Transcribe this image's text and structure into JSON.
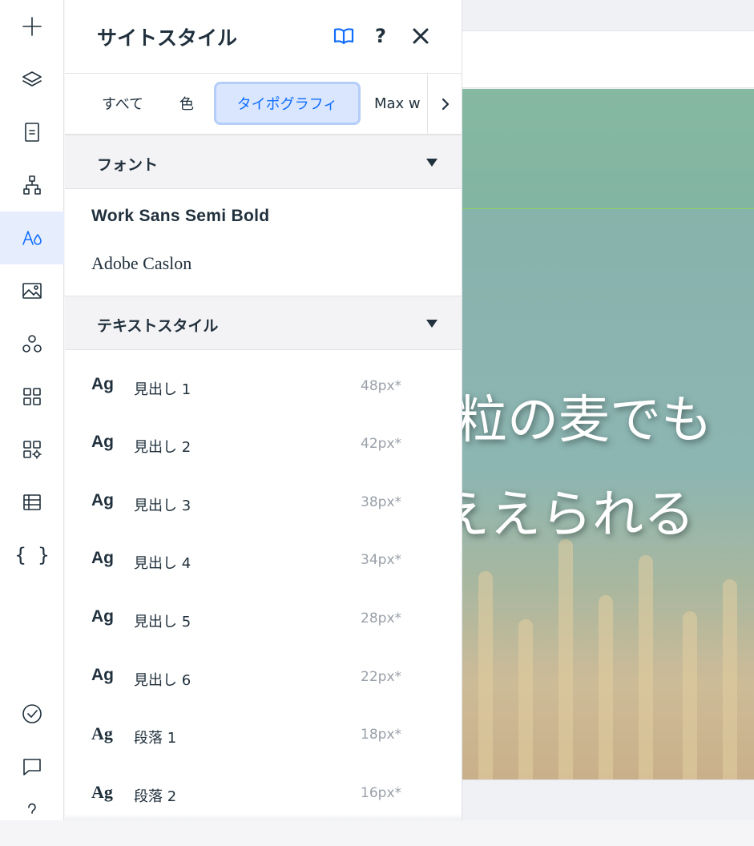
{
  "rail": {
    "items": [
      {
        "name": "add-icon",
        "active": false
      },
      {
        "name": "layers-icon",
        "active": false
      },
      {
        "name": "pages-icon",
        "active": false
      },
      {
        "name": "sitemap-icon",
        "active": false
      },
      {
        "name": "site-styles-icon",
        "active": true
      },
      {
        "name": "media-icon",
        "active": false
      },
      {
        "name": "apps-network-icon",
        "active": false
      },
      {
        "name": "app-market-icon",
        "active": false
      },
      {
        "name": "business-tools-icon",
        "active": false
      },
      {
        "name": "cms-table-icon",
        "active": false
      },
      {
        "name": "code-braces-icon",
        "active": false
      }
    ],
    "bottom_items": [
      {
        "name": "site-check-icon"
      },
      {
        "name": "chat-icon"
      },
      {
        "name": "help-icon"
      }
    ],
    "braces_glyph": "{ }"
  },
  "panel": {
    "title": "サイトスタイル",
    "help_glyph": "?",
    "tabs": {
      "all": "すべて",
      "color": "色",
      "typography": "タイポグラフィ",
      "max_width": "Max w"
    },
    "fonts_section": "フォント",
    "fonts": [
      "Work Sans Semi Bold",
      "Adobe Caslon"
    ],
    "text_styles_section": "テキストスタイル",
    "text_styles": [
      {
        "ag": "Ag",
        "name": "見出し 1",
        "size": "48px*"
      },
      {
        "ag": "Ag",
        "name": "見出し 2",
        "size": "42px*"
      },
      {
        "ag": "Ag",
        "name": "見出し 3",
        "size": "38px*"
      },
      {
        "ag": "Ag",
        "name": "見出し 4",
        "size": "34px*"
      },
      {
        "ag": "Ag",
        "name": "見出し 5",
        "size": "28px*"
      },
      {
        "ag": "Ag",
        "name": "見出し 6",
        "size": "22px*"
      },
      {
        "ag": "Ag",
        "name": "段落 1",
        "size": "18px*"
      },
      {
        "ag": "Ag",
        "name": "段落 2",
        "size": "16px*"
      }
    ]
  },
  "canvas": {
    "hero_line_1": "粒の麦でも",
    "hero_line_2": "ええられる"
  },
  "colors": {
    "accent": "#116dff",
    "text": "#20303c",
    "muted": "#9aa0a9",
    "active_tab_bg": "#d9e6fd"
  }
}
